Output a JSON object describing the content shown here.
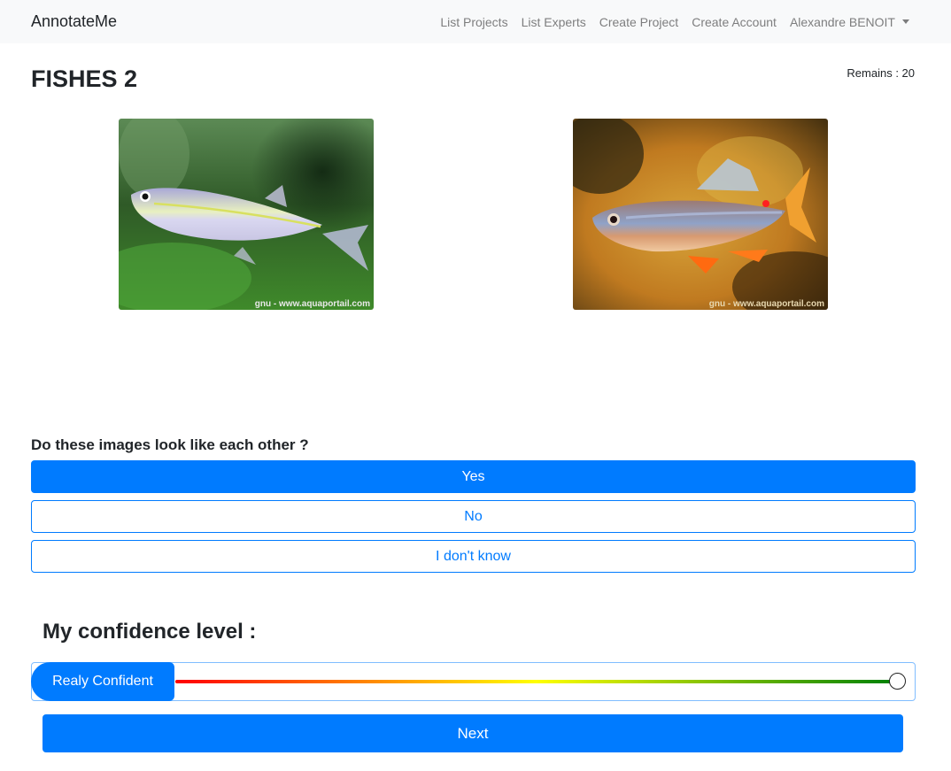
{
  "navbar": {
    "brand": "AnnotateMe",
    "links": [
      "List Projects",
      "List Experts",
      "Create Project",
      "Create Account"
    ],
    "user": "Alexandre BENOIT"
  },
  "project": {
    "title": "FISHES 2",
    "remains": "Remains : 20"
  },
  "images": {
    "left_watermark": "gnu - www.aquaportail.com",
    "right_watermark": "gnu - www.aquaportail.com"
  },
  "question": {
    "text": "Do these images look like each other ?",
    "options": [
      "Yes",
      "No",
      "I don't know"
    ],
    "selected": "Yes"
  },
  "confidence": {
    "title": "My confidence level :",
    "label": "Realy Confident",
    "level": 1.0,
    "colors": [
      "#ff0000",
      "#ff7f00",
      "#ffff00",
      "#7fbf00",
      "#008000"
    ]
  },
  "next_label": "Next",
  "colors": {
    "primary": "#007bff",
    "navbar_bg": "#f8f9fa"
  }
}
